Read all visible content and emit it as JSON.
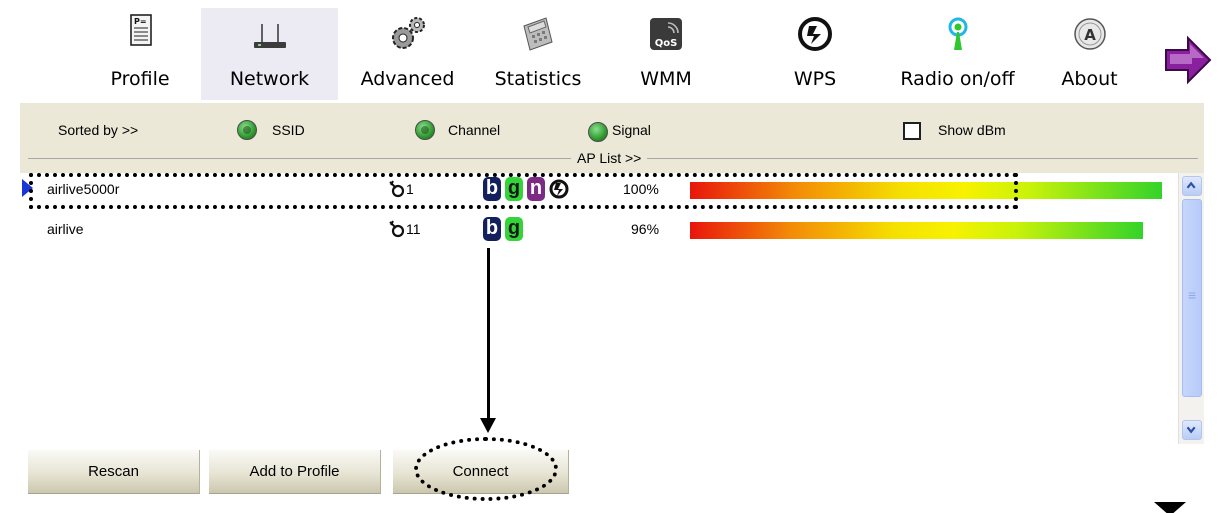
{
  "toolbar": {
    "items": [
      {
        "label": "Profile",
        "icon": "profile-icon"
      },
      {
        "label": "Network",
        "icon": "network-icon",
        "selected": true
      },
      {
        "label": "Advanced",
        "icon": "advanced-gears-icon"
      },
      {
        "label": "Statistics",
        "icon": "statistics-calculator-icon"
      },
      {
        "label": "WMM",
        "icon": "qos-icon",
        "icon_text": "QoS"
      },
      {
        "label": "WPS",
        "icon": "wps-icon"
      },
      {
        "label": "Radio on/off",
        "icon": "radio-antenna-icon"
      },
      {
        "label": "About",
        "icon": "about-icon"
      }
    ],
    "next_icon": "next-arrow-icon"
  },
  "sort": {
    "label": "Sorted by >>",
    "options": [
      {
        "label": "SSID",
        "selected": true
      },
      {
        "label": "Channel",
        "selected": true
      },
      {
        "label": "Signal",
        "selected": false
      }
    ],
    "show_dbm_label": "Show dBm",
    "show_dbm_checked": false
  },
  "ap_list": {
    "title": "AP List >>",
    "rows": [
      {
        "ssid": "airlive5000r",
        "channel": "1",
        "modes": [
          "b",
          "g",
          "n"
        ],
        "wps": true,
        "signal": "100%",
        "signal_value": 100,
        "selected": true
      },
      {
        "ssid": "airlive",
        "channel": "11",
        "modes": [
          "b",
          "g"
        ],
        "wps": false,
        "signal": "96%",
        "signal_value": 96,
        "selected": false
      }
    ]
  },
  "buttons": {
    "rescan": "Rescan",
    "add_to_profile": "Add to Profile",
    "connect": "Connect"
  },
  "colors": {
    "panel_bg": "#ebe8d8",
    "selected_tab_bg": "#ecebf3",
    "mode_b": "#14205e",
    "mode_g": "#35d33a",
    "mode_n": "#7c2a84"
  }
}
